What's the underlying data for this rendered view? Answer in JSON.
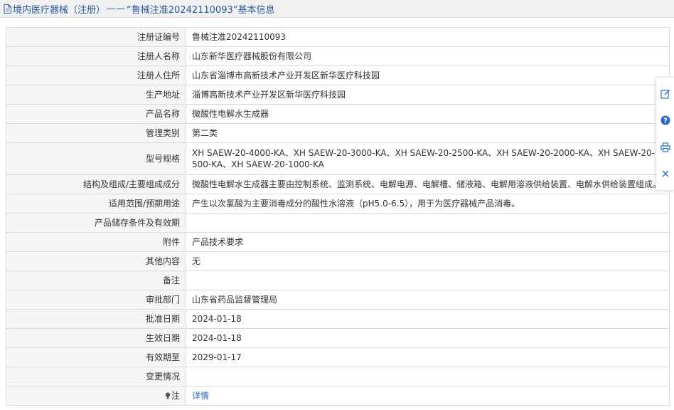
{
  "header": {
    "section": "境内医疗器械（注册）",
    "separator": "——",
    "title": "“鲁械注准20242110093”基本信息"
  },
  "rows": [
    {
      "label": "注册证编号",
      "value": "鲁械注准20242110093"
    },
    {
      "label": "注册人名称",
      "value": "山东新华医疗器械股份有限公司"
    },
    {
      "label": "注册人住所",
      "value": "山东省淄博市高新技术产业开发区新华医疗科技园"
    },
    {
      "label": "生产地址",
      "value": "淄博高新技术产业开发区新华医疗科技园"
    },
    {
      "label": "产品名称",
      "value": "微酸性电解水生成器"
    },
    {
      "label": "管理类别",
      "value": "第二类"
    },
    {
      "label": "型号规格",
      "value": "XH SAEW-20-4000-KA、XH SAEW-20-3000-KA、XH SAEW-20-2500-KA、XH SAEW-20-2000-KA、XH SAEW-20-1500-KA、XH SAEW-20-1000-KA"
    },
    {
      "label": "结构及组成/主要组成成分",
      "value": "微酸性电解水生成器主要由控制系统、监测系统、电解电源、电解槽、储液箱、电解用溶液供给装置、电解水供给装置组成。"
    },
    {
      "label": "适用范围/预期用途",
      "value": "产生以次氯酸为主要消毒成分的酸性水溶液（pH5.0-6.5），用于为医疗器械产品消毒。"
    },
    {
      "label": "产品储存条件及有效期",
      "value": ""
    },
    {
      "label": "附件",
      "value": "产品技术要求"
    },
    {
      "label": "其他内容",
      "value": "无"
    },
    {
      "label": "备注",
      "value": ""
    },
    {
      "label": "审批部门",
      "value": "山东省药品监督管理局"
    },
    {
      "label": "批准日期",
      "value": "2024-01-18"
    },
    {
      "label": "生效日期",
      "value": "2024-01-18"
    },
    {
      "label": "有效期至",
      "value": "2029-01-17"
    },
    {
      "label": "变更情况",
      "value": ""
    }
  ],
  "note_row": {
    "label": "注",
    "link": "详情"
  },
  "colors": {
    "accent": "#2a5a9a",
    "link": "#2a6ac8",
    "label_bg": "#f5f5f5",
    "border": "#dcdcdc"
  },
  "toolbar": [
    "edit-icon",
    "info-icon",
    "print-icon",
    "close-icon"
  ]
}
